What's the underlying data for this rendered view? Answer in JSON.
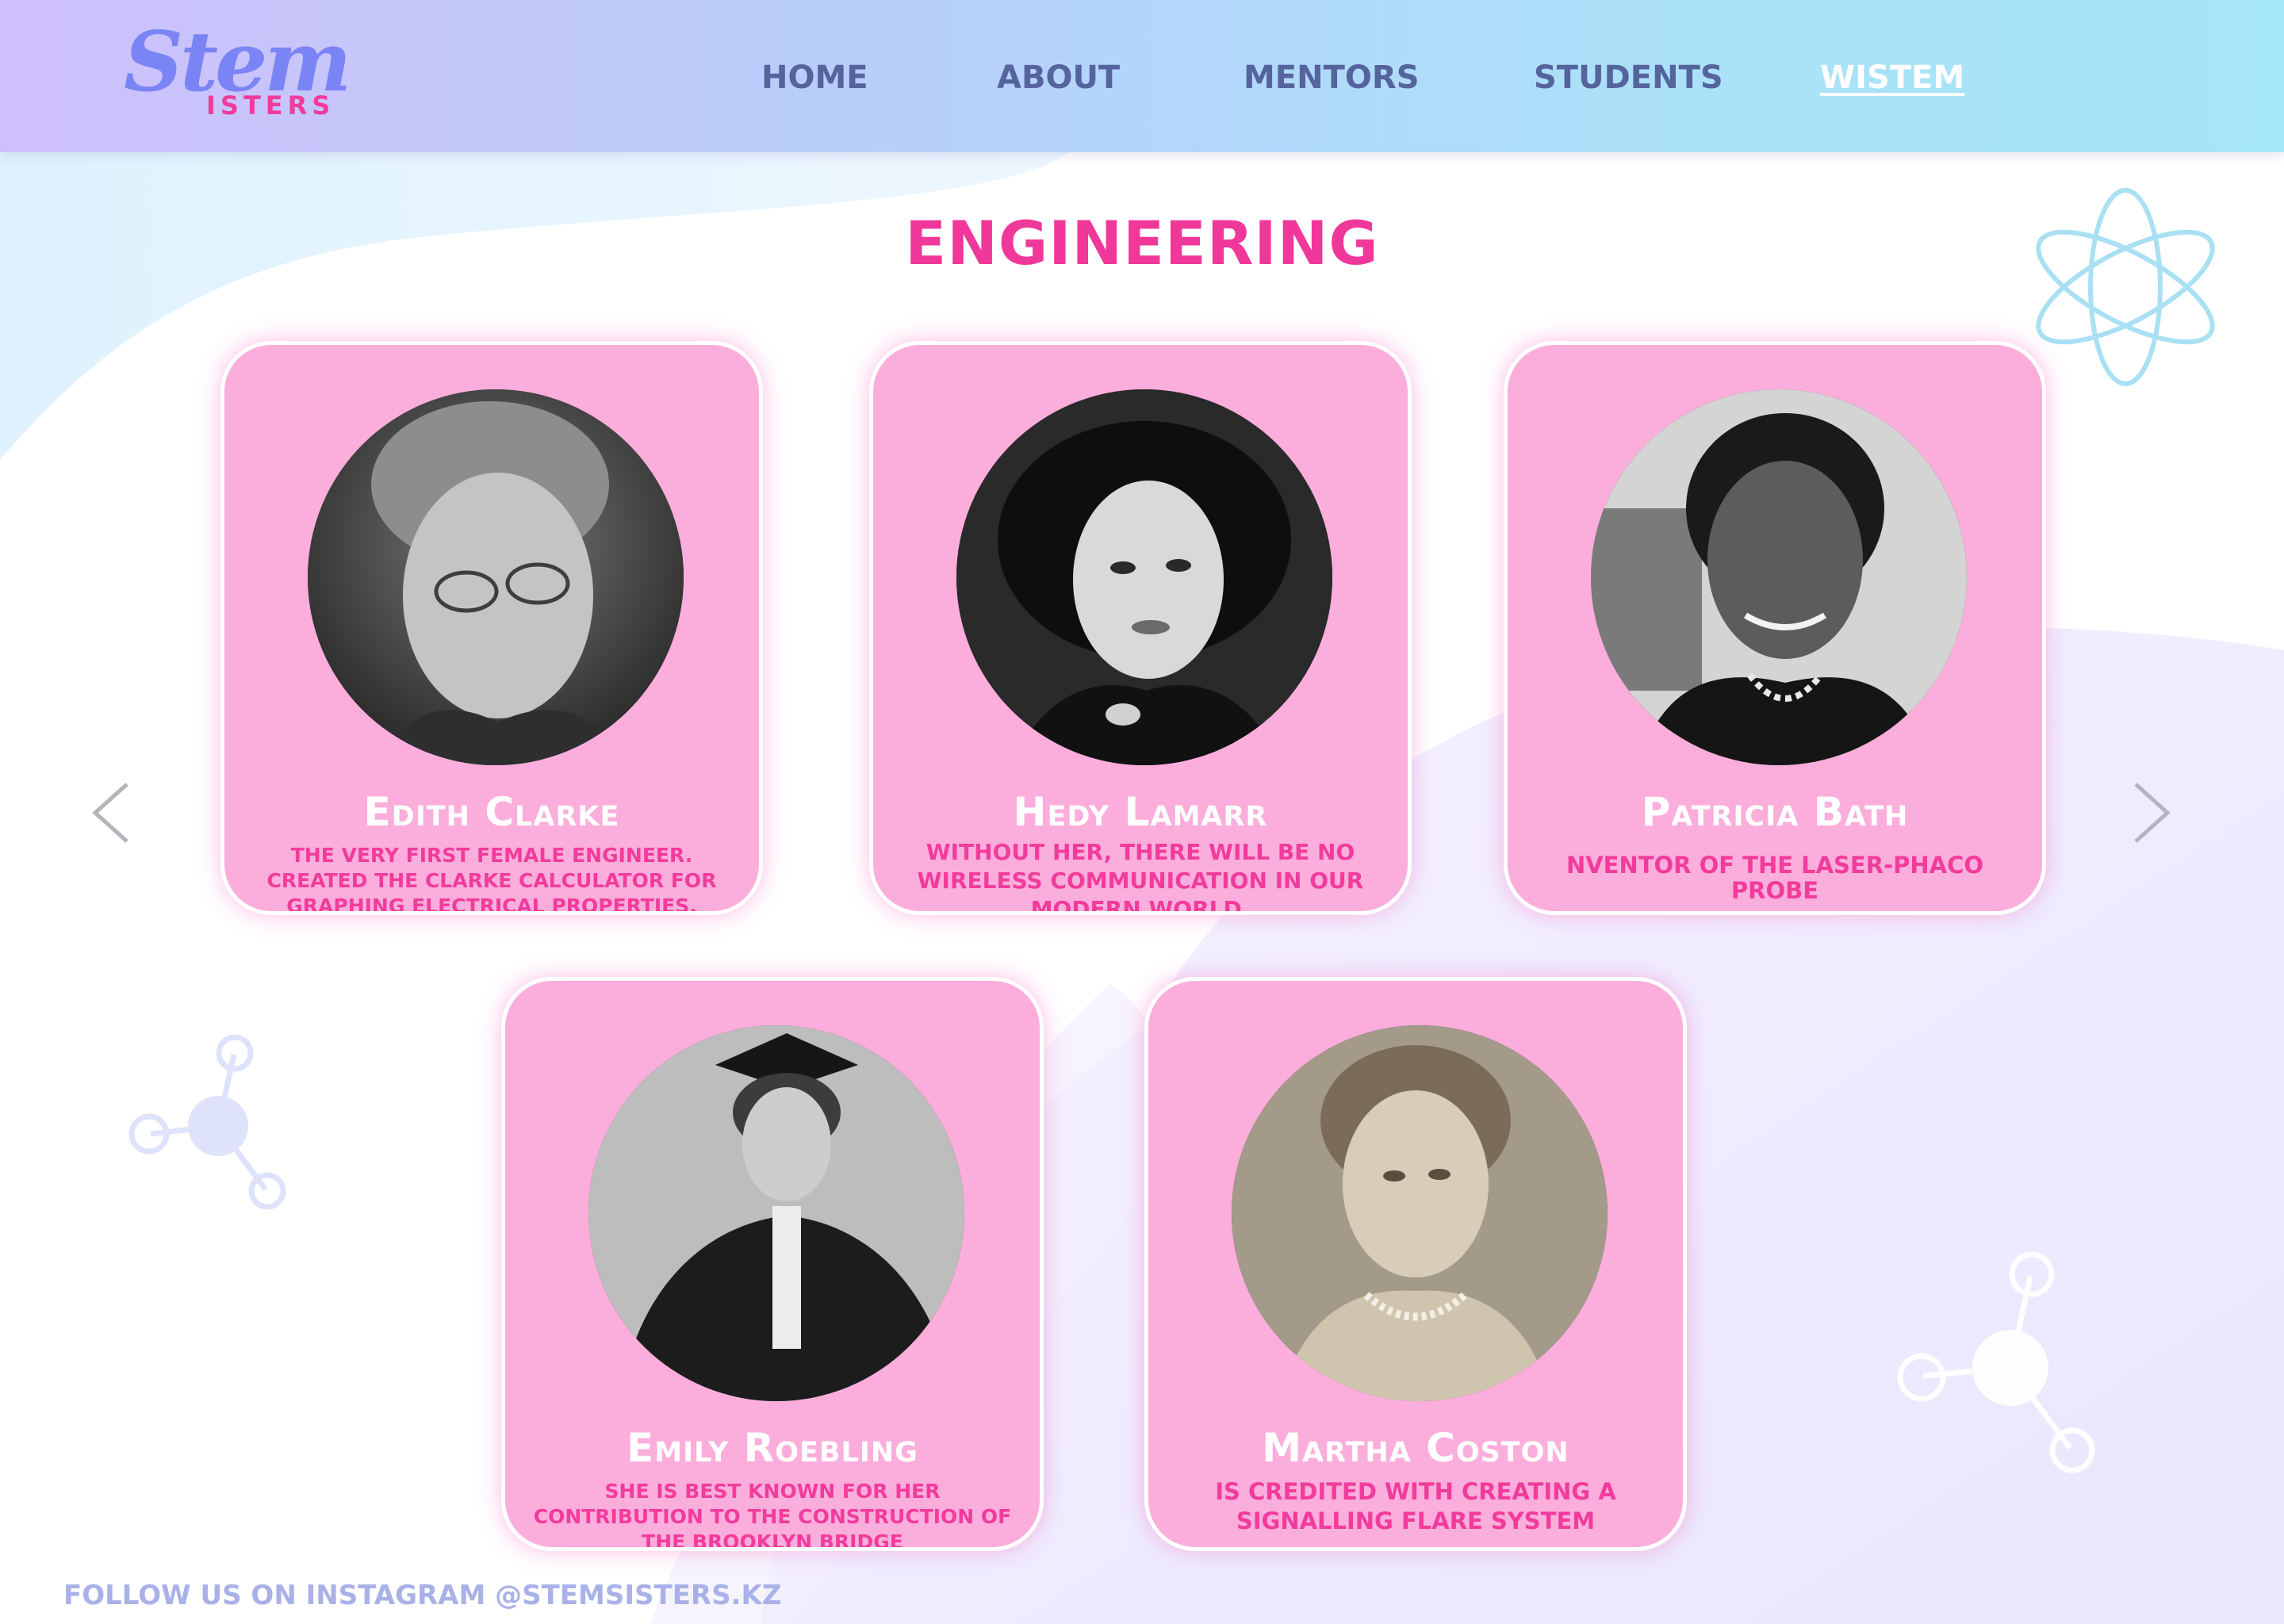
{
  "logo": {
    "script": "Stem",
    "sub": "ISTERS"
  },
  "nav": [
    {
      "label": "HOME"
    },
    {
      "label": "ABOUT"
    },
    {
      "label": "MENTORS"
    },
    {
      "label": "STUDENTS"
    },
    {
      "label": "WISTEM"
    }
  ],
  "active_nav": "WISTEM",
  "page_title": "ENGINEERING",
  "cards": [
    {
      "name": "Edith Clarke",
      "description": "The very first female engineer. Created the Clarke calculator for graphing electrical properties."
    },
    {
      "name": "Hedy Lamarr",
      "description": "Without her, there will be no wireless communication in our modern world."
    },
    {
      "name": "Patricia Bath",
      "description": "nventor of the laser-phaco probe"
    },
    {
      "name": "Emily Roebling",
      "description": "She is best known for her contribution to the construction of the Brooklyn Bridge"
    },
    {
      "name": "Martha Coston",
      "description": "is credited with creating a signalling flare system"
    }
  ],
  "footer": {
    "instagram": "FOLLOW US ON INSTAGRAM @STEMSISTERS.KZ"
  },
  "colors": {
    "accent_pink": "#f0389a",
    "card_pink": "#fbaedb",
    "nav_text": "#55649c",
    "footer_text": "#a9b1e8"
  },
  "icons": {
    "prev": "chevron-left-icon",
    "next": "chevron-right-icon",
    "decorations": [
      "atom-icon",
      "molecule-icon"
    ]
  }
}
